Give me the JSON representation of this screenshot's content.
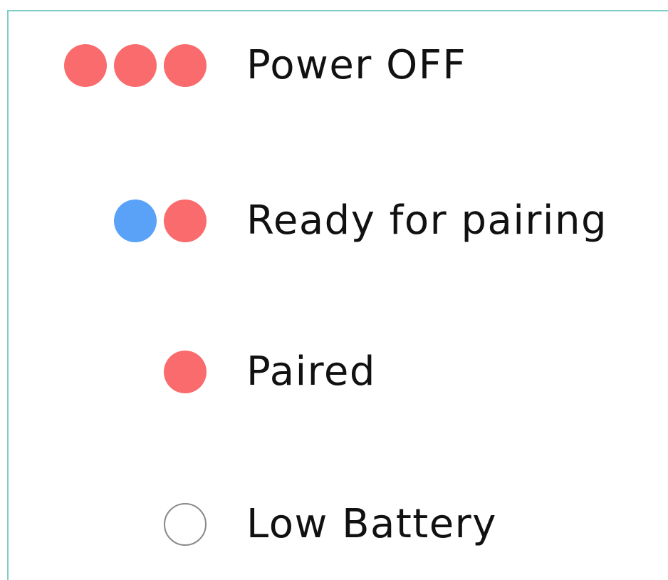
{
  "colors": {
    "red": "#f96b6c",
    "blue": "#5aa2f8",
    "off_border": "#888888",
    "panel_border": "#7fcdc4"
  },
  "states": [
    {
      "label": "Power OFF",
      "dots": [
        "red",
        "red",
        "red"
      ]
    },
    {
      "label": "Ready for pairing",
      "dots": [
        "blue",
        "red"
      ]
    },
    {
      "label": "Paired",
      "dots": [
        "red"
      ]
    },
    {
      "label": "Low Battery",
      "dots": [
        "off"
      ]
    }
  ]
}
